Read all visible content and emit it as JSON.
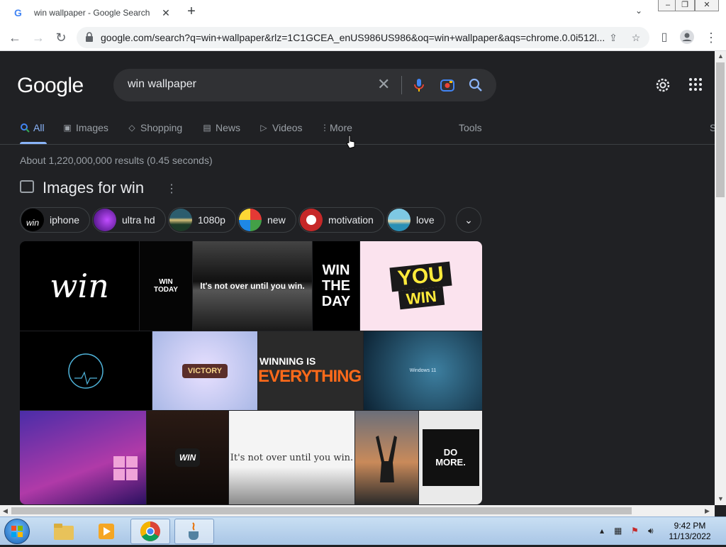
{
  "browser": {
    "tab_title": "win wallpaper - Google Search",
    "tab_favicon": "G",
    "url": "google.com/search?q=win+wallpaper&rlz=1C1GCEA_enUS986US986&oq=win+wallpaper&aqs=chrome.0.0i512l..."
  },
  "google": {
    "logo": "Google",
    "query": "win wallpaper",
    "tabs": [
      {
        "label": "All",
        "icon": "search-icon",
        "active": true
      },
      {
        "label": "Images",
        "icon": "image-icon"
      },
      {
        "label": "Shopping",
        "icon": "tag-icon"
      },
      {
        "label": "News",
        "icon": "news-icon"
      },
      {
        "label": "Videos",
        "icon": "video-icon"
      },
      {
        "label": "More",
        "icon": "kebab-icon"
      }
    ],
    "tools_label": "Tools",
    "safesearch_partial": "S",
    "stats": "About 1,220,000,000 results (0.45 seconds)",
    "images_heading": "Images for win",
    "chips": [
      "iphone",
      "ultra hd",
      "1080p",
      "new",
      "motivation",
      "love"
    ],
    "thumb_texts": {
      "t1": "win",
      "t2": "WIN TODAY",
      "t3": "It's not over until you win.",
      "t4": "WIN THE DAY",
      "t5a": "YOU",
      "t5b": "WIN",
      "t6": "Windows",
      "t7": "VICTORY",
      "t8a": "WINNING IS",
      "t8b": "EVERYTHING",
      "t9": "Windows 11",
      "t11": "WIN",
      "t12": "It's not over until you win.",
      "t14a": "DO",
      "t14b": "MORE."
    }
  },
  "taskbar": {
    "time": "9:42 PM",
    "date": "11/13/2022"
  },
  "colors": {
    "bg": "#202124",
    "link_blue": "#8ab4f8",
    "text_secondary": "#9aa0a6"
  }
}
